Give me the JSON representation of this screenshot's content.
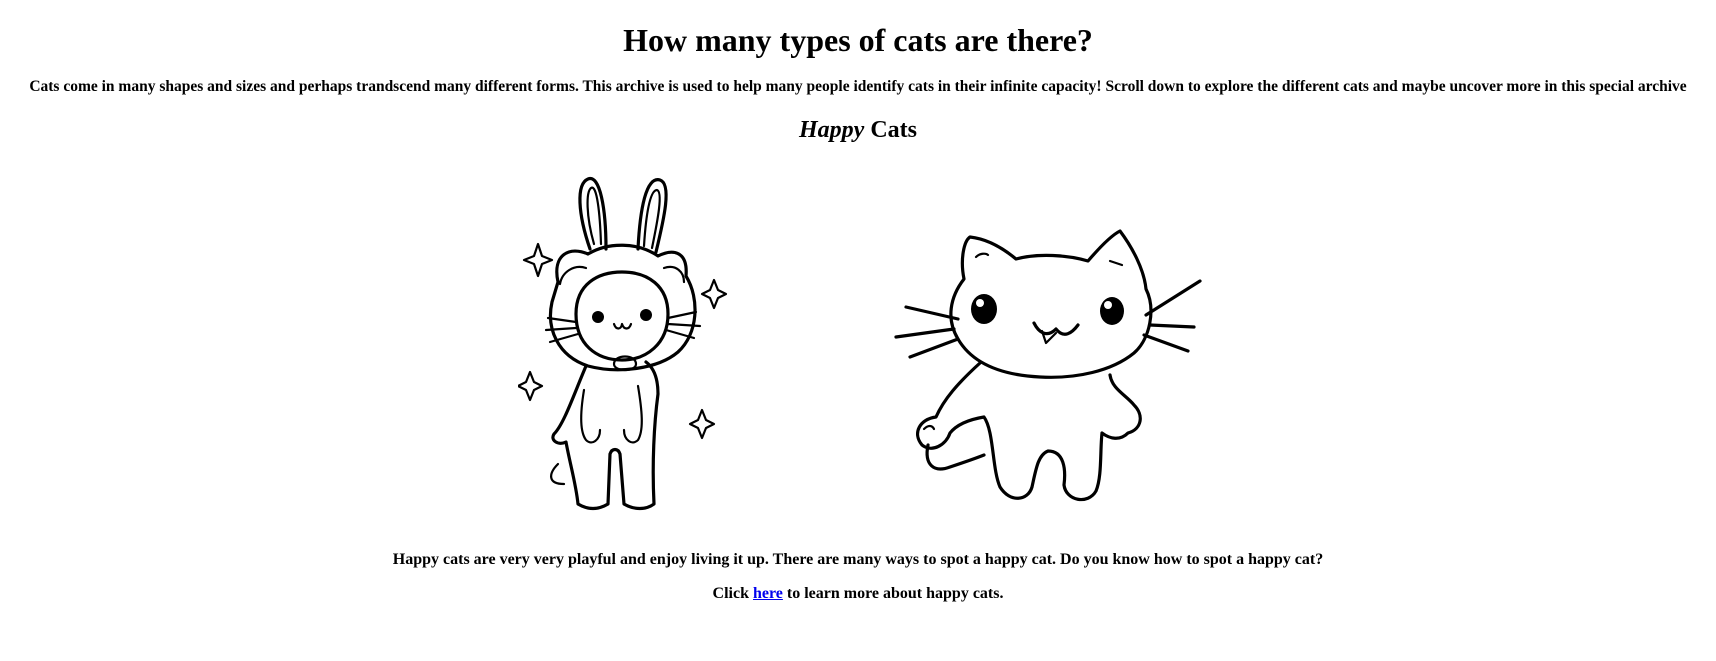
{
  "page": {
    "title": "How many types of cats are there?",
    "intro": "Cats come in many shapes and sizes and perhaps trandscend many different forms. This archive is used to help many people identify cats in their infinite capacity! Scroll down to explore the different cats and maybe uncover more in this special archive"
  },
  "section": {
    "title_emphasis": "Happy",
    "title_rest": " Cats",
    "description": "Happy cats are very very playful and enjoy living it up. There are many ways to spot a happy cat. Do you know how to spot a happy cat?",
    "click_prefix": "Click ",
    "link_text": "here",
    "click_suffix": " to learn more about happy cats."
  },
  "images": [
    {
      "name": "bunny-costume-cat"
    },
    {
      "name": "waving-cat"
    }
  ]
}
